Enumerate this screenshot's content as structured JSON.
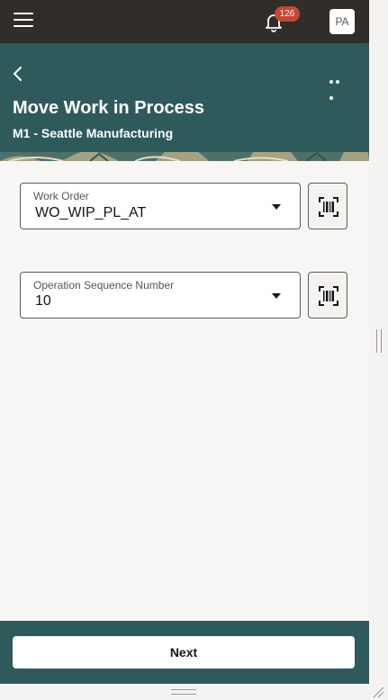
{
  "topbar": {
    "menu_icon": "hamburger-icon",
    "notification_icon": "bell-icon",
    "notification_count": "126",
    "avatar_initials": "PA"
  },
  "header": {
    "back_icon": "chevron-left-icon",
    "more_icon": "more-horizontal-icon",
    "title": "Move Work in Process",
    "subtitle": "M1 - Seattle Manufacturing"
  },
  "form": {
    "work_order": {
      "label": "Work Order",
      "value": "WO_WIP_PL_AT"
    },
    "operation_sequence": {
      "label": "Operation Sequence Number",
      "value": "10"
    },
    "scan_icon": "barcode-scan-icon"
  },
  "footer": {
    "next_label": "Next"
  },
  "colors": {
    "topbar": "#302d2b",
    "header": "#2f5a5c",
    "badge": "#c74634",
    "background": "#f8f6f4"
  }
}
